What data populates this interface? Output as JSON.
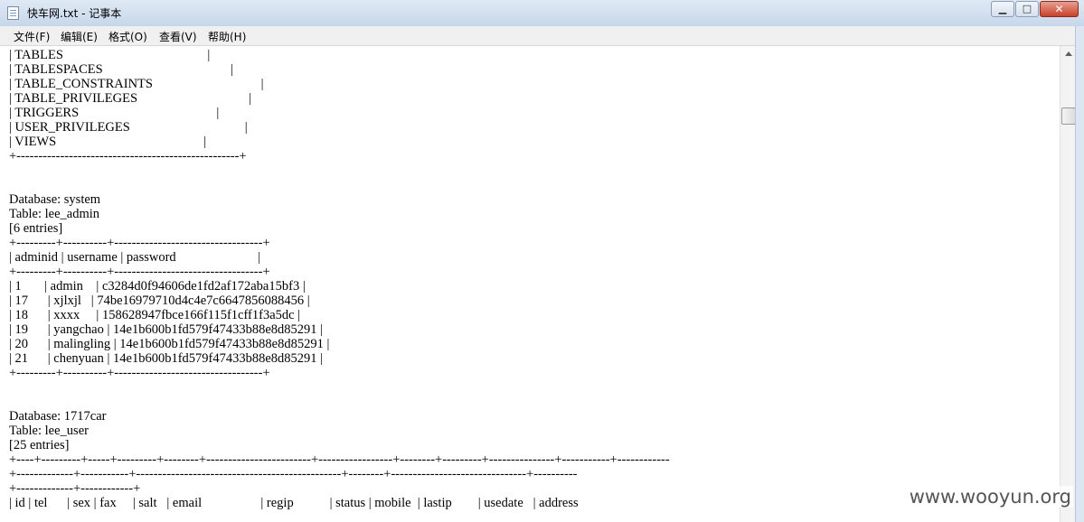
{
  "window": {
    "title": "快车网.txt - 记事本",
    "minimize_glyph": "▁",
    "maximize_glyph": "□",
    "close_glyph": "✕"
  },
  "menu": {
    "file": "文件(F)",
    "edit": "编辑(E)",
    "format": "格式(O)",
    "view": "查看(V)",
    "help": "帮助(H)"
  },
  "document": {
    "text": "| TABLES                                            |\n| TABLESPACES                                       |\n| TABLE_CONSTRAINTS                                 |\n| TABLE_PRIVILEGES                                  |\n| TRIGGERS                                          |\n| USER_PRIVILEGES                                   |\n| VIEWS                                             |\n+---------------------------------------------------+\n\n\nDatabase: system\nTable: lee_admin\n[6 entries]\n+---------+----------+----------------------------------+\n| adminid | username | password                         |\n+---------+----------+----------------------------------+\n| 1       | admin    | c3284d0f94606de1fd2af172aba15bf3 |\n| 17      | xjlxjl   | 74be16979710d4c4e7c6647856088456 |\n| 18      | xxxx     | 158628947fbce166f115f1cff1f3a5dc |\n| 19      | yangchao | 14e1b600b1fd579f47433b88e8d85291 |\n| 20      | malingling | 14e1b600b1fd579f47433b88e8d85291 |\n| 21      | chenyuan | 14e1b600b1fd579f47433b88e8d85291 |\n+---------+----------+----------------------------------+\n\n\nDatabase: 1717car\nTable: lee_user\n[25 entries]\n+----+---------+-----+---------+--------+------------------------+-----------------+--------+---------+---------------+-----------+------------\n+-------------+-----------+-----------------------------------------------+--------+-------------------------------+----------\n+-------------+------------+\n| id | tel      | sex | fax     | salt   | email                  | regip           | status | mobile  | lastip        | usedate   | address"
  },
  "watermark": "www.wooyun.org"
}
